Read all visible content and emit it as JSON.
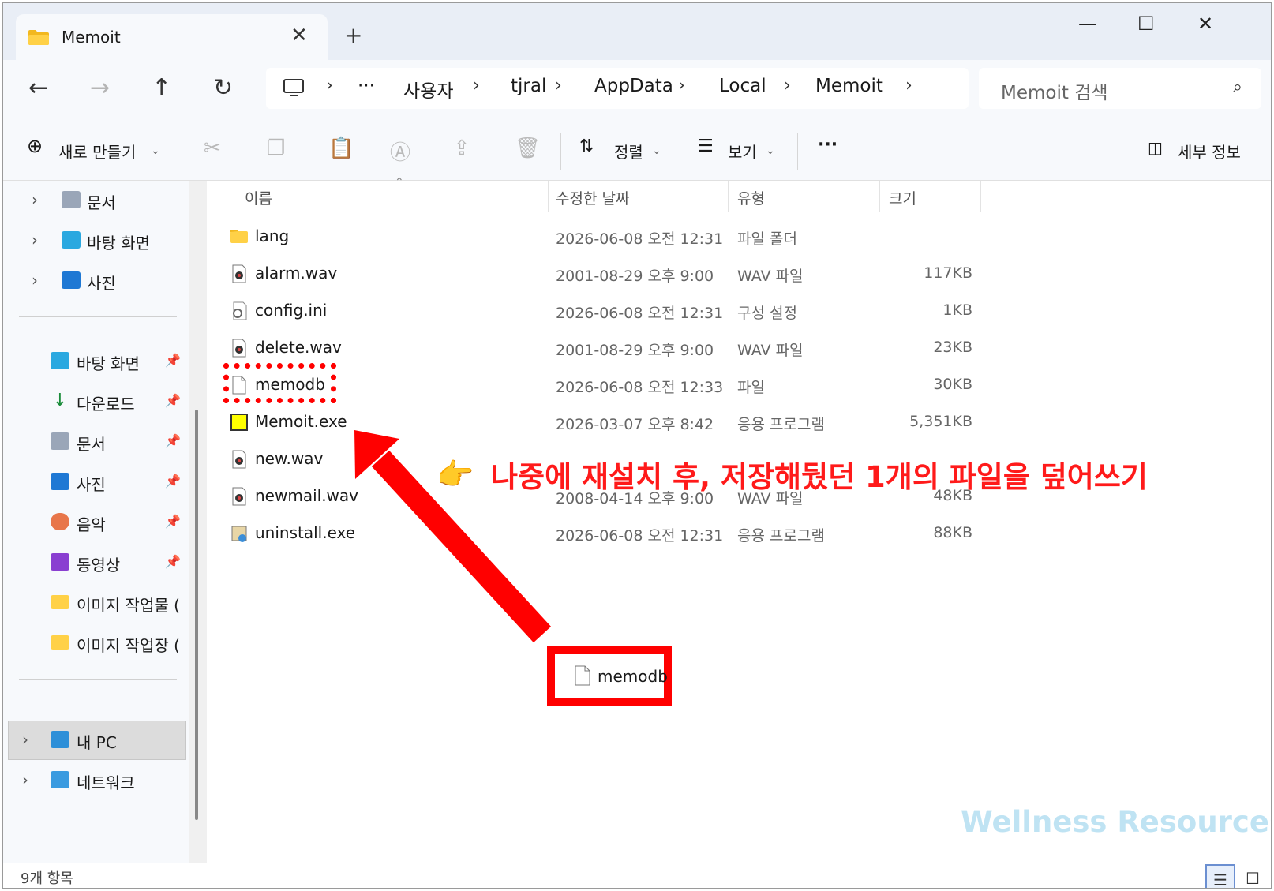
{
  "tab": {
    "title": "Memoit",
    "close": "✕",
    "new_tab": "+"
  },
  "window_controls": {
    "minimize": "—",
    "maximize": "☐",
    "close": "✕"
  },
  "nav": {
    "back": "←",
    "forward": "→",
    "up": "↑",
    "refresh": "↻"
  },
  "address": {
    "overflow": "···",
    "crumbs": [
      "사용자",
      "tjral",
      "AppData",
      "Local",
      "Memoit"
    ],
    "sep": "›"
  },
  "search": {
    "placeholder": "Memoit 검색",
    "icon": "⌕"
  },
  "toolbar": {
    "new_label": "새로 만들기",
    "sort_label": "정렬",
    "view_label": "보기",
    "more": "···",
    "details_label": "세부 정보"
  },
  "sidebar": {
    "top_items": [
      {
        "label": "문서",
        "icon": "documents-icon"
      },
      {
        "label": "바탕 화면",
        "icon": "desktop-icon"
      },
      {
        "label": "사진",
        "icon": "pictures-icon"
      }
    ],
    "quick_items": [
      {
        "label": "바탕 화면",
        "icon": "desktop-icon"
      },
      {
        "label": "다운로드",
        "icon": "download-icon"
      },
      {
        "label": "문서",
        "icon": "documents-icon"
      },
      {
        "label": "사진",
        "icon": "pictures-icon"
      },
      {
        "label": "음악",
        "icon": "music-icon"
      },
      {
        "label": "동영상",
        "icon": "videos-icon"
      },
      {
        "label": "이미지 작업물 (",
        "icon": "folder-icon"
      },
      {
        "label": "이미지 작업장 (",
        "icon": "folder-icon"
      }
    ],
    "bottom_items": [
      {
        "label": "내 PC",
        "icon": "pc-icon"
      },
      {
        "label": "네트워크",
        "icon": "network-icon"
      }
    ]
  },
  "columns": {
    "name": "이름",
    "date": "수정한 날짜",
    "type": "유형",
    "size": "크기"
  },
  "files": [
    {
      "name": "lang",
      "date": "2026-06-08 오전 12:31",
      "type": "파일 폴더",
      "size": "",
      "icon": "folder-icon"
    },
    {
      "name": "alarm.wav",
      "date": "2001-08-29 오후 9:00",
      "type": "WAV 파일",
      "size": "117KB",
      "icon": "audio-file-icon"
    },
    {
      "name": "config.ini",
      "date": "2026-06-08 오전 12:31",
      "type": "구성 설정",
      "size": "1KB",
      "icon": "settings-file-icon"
    },
    {
      "name": "delete.wav",
      "date": "2001-08-29 오후 9:00",
      "type": "WAV 파일",
      "size": "23KB",
      "icon": "audio-file-icon"
    },
    {
      "name": "memodb",
      "date": "2026-06-08 오전 12:33",
      "type": "파일",
      "size": "30KB",
      "icon": "blank-file-icon"
    },
    {
      "name": "Memoit.exe",
      "date": "2026-03-07 오후 8:42",
      "type": "응용 프로그램",
      "size": "5,351KB",
      "icon": "app-icon"
    },
    {
      "name": "new.wav",
      "date": "",
      "type": "",
      "size": "",
      "icon": "audio-file-icon"
    },
    {
      "name": "newmail.wav",
      "date": "2008-04-14 오후 9:00",
      "type": "WAV 파일",
      "size": "48KB",
      "icon": "audio-file-icon"
    },
    {
      "name": "uninstall.exe",
      "date": "2026-06-08 오전 12:31",
      "type": "응용 프로그램",
      "size": "88KB",
      "icon": "installer-icon"
    }
  ],
  "annotation": {
    "text": "나중에 재설치 후, 저장해뒀던 1개의 파일을 덮어쓰기",
    "hand": "👉",
    "dropped_file": "memodb",
    "color": "#ff0000"
  },
  "watermark": "Wellness Resources",
  "status": {
    "count": "9개 항목"
  }
}
